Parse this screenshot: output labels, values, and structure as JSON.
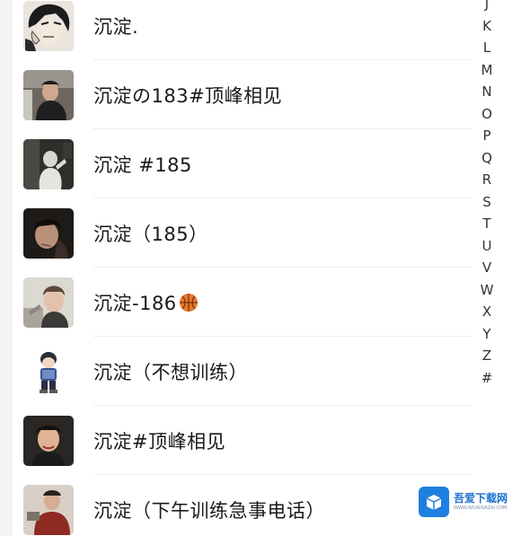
{
  "contacts": [
    {
      "name": "沉淀."
    },
    {
      "name": "沉淀の183#顶峰相见"
    },
    {
      "name": "沉淀 #185"
    },
    {
      "name": "沉淀（185）"
    },
    {
      "name": "沉淀-186",
      "emoji": "basketball-icon"
    },
    {
      "name": "沉淀（不想训练）"
    },
    {
      "name": "沉淀#顶峰相见"
    },
    {
      "name": "沉淀（下午训练急事电话）"
    }
  ],
  "index_letters": [
    "J",
    "K",
    "L",
    "M",
    "N",
    "O",
    "P",
    "Q",
    "R",
    "S",
    "T",
    "U",
    "V",
    "W",
    "X",
    "Y",
    "Z",
    "#"
  ],
  "watermark": {
    "title": "吾爱下载网",
    "subtitle": "WWW.WUAIXIAZAI.COM",
    "icon": "box-icon"
  },
  "colors": {
    "text": "#1a1a1a",
    "index": "#333333",
    "watermark_blue": "#1e7fe0",
    "basketball": "#e8762b"
  }
}
